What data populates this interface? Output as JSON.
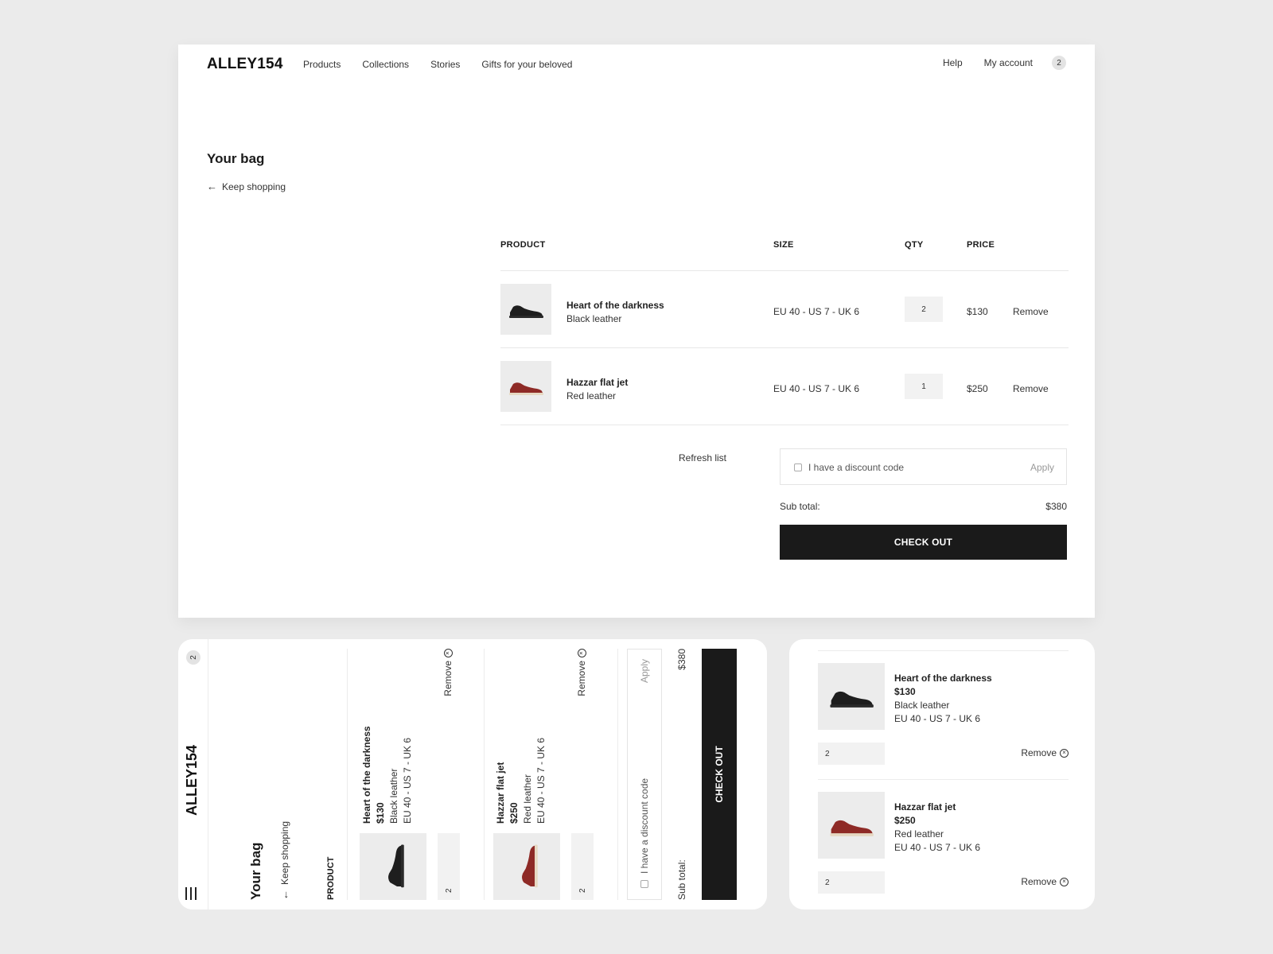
{
  "brand": "ALLEY154",
  "nav": {
    "items": [
      "Products",
      "Collections",
      "Stories",
      "Gifts for your beloved"
    ],
    "help": "Help",
    "account": "My account",
    "bag_count": "2"
  },
  "page": {
    "title": "Your bag",
    "keep_shopping": "Keep shopping"
  },
  "table": {
    "headers": {
      "product": "PRODUCT",
      "size": "SIZE",
      "qty": "QTY",
      "price": "PRICE"
    },
    "remove_label": "Remove"
  },
  "items": [
    {
      "name": "Heart of the darkness",
      "variant": "Black leather",
      "size": "EU 40 - US 7 - UK 6",
      "qty": "2",
      "price": "$130",
      "color": "#1e1e1e",
      "sole": "#2a2a2a"
    },
    {
      "name": "Hazzar flat jet",
      "variant": "Red leather",
      "size": "EU 40 - US 7 - UK 6",
      "qty": "1",
      "price": "$250",
      "color": "#8e2a26",
      "sole": "#e6d8c2"
    }
  ],
  "mobile_qty": [
    "2",
    "2"
  ],
  "footer": {
    "refresh": "Refresh list",
    "discount_label": "I have a discount code",
    "apply": "Apply",
    "subtotal_label": "Sub total:",
    "subtotal_value": "$380",
    "checkout": "CHECK OUT"
  },
  "colors": {
    "background": "#ebebeb",
    "panel": "#ffffff",
    "button": "#1a1a1a",
    "thumb": "#ececec"
  }
}
